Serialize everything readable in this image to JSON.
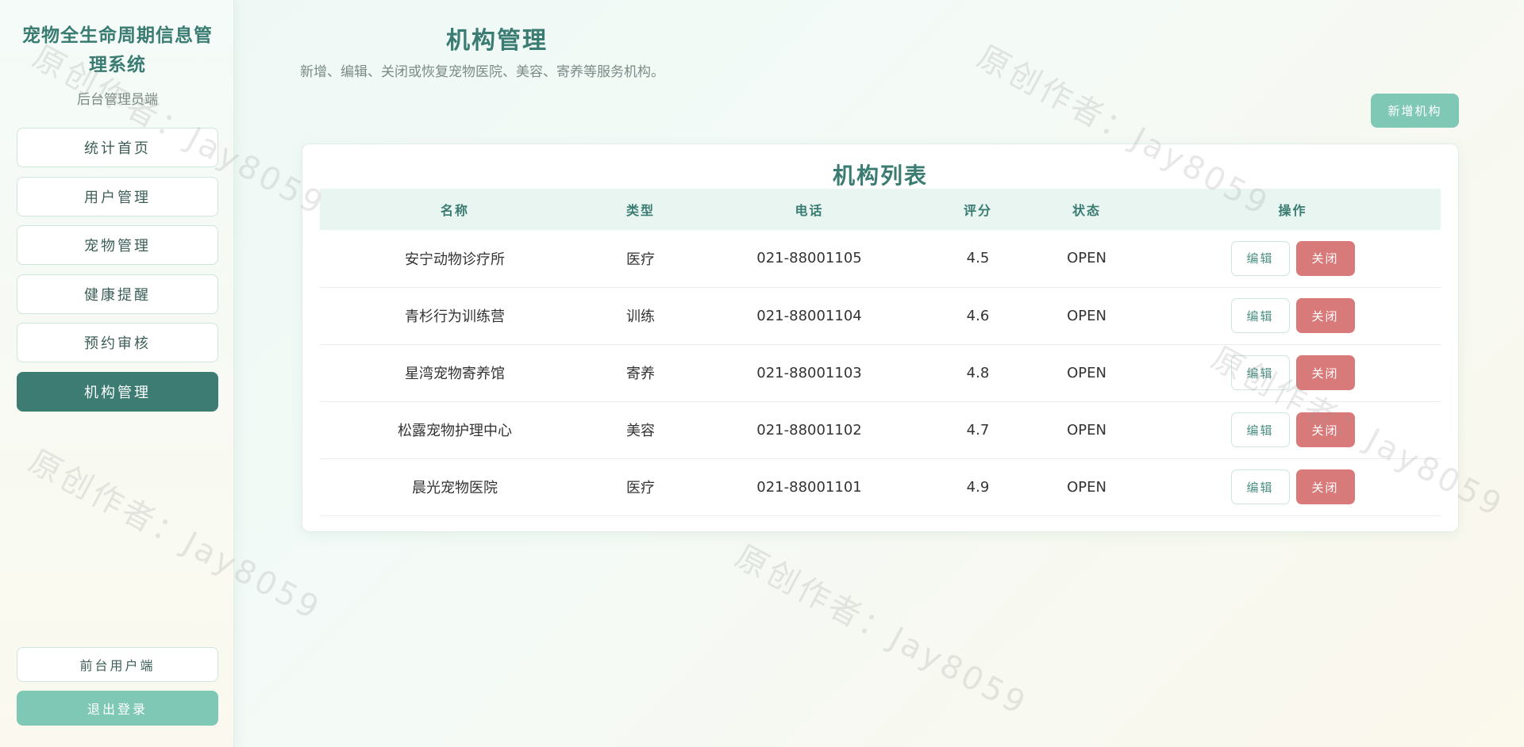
{
  "sidebar": {
    "title": "宠物全生命周期信息管理系统",
    "subtitle": "后台管理员端",
    "nav": [
      {
        "label": "统计首页",
        "active": false
      },
      {
        "label": "用户管理",
        "active": false
      },
      {
        "label": "宠物管理",
        "active": false
      },
      {
        "label": "健康提醒",
        "active": false
      },
      {
        "label": "预约审核",
        "active": false
      },
      {
        "label": "机构管理",
        "active": true
      }
    ],
    "front_label": "前台用户端",
    "logout_label": "退出登录"
  },
  "header": {
    "title": "机构管理",
    "subtitle": "新增、编辑、关闭或恢复宠物医院、美容、寄养等服务机构。",
    "add_label": "新增机构"
  },
  "table": {
    "title": "机构列表",
    "columns": [
      "名称",
      "类型",
      "电话",
      "评分",
      "状态",
      "操作"
    ],
    "rows": [
      {
        "name": "安宁动物诊疗所",
        "type": "医疗",
        "phone": "021-88001105",
        "rating": "4.5",
        "status": "OPEN"
      },
      {
        "name": "青杉行为训练营",
        "type": "训练",
        "phone": "021-88001104",
        "rating": "4.6",
        "status": "OPEN"
      },
      {
        "name": "星湾宠物寄养馆",
        "type": "寄养",
        "phone": "021-88001103",
        "rating": "4.8",
        "status": "OPEN"
      },
      {
        "name": "松露宠物护理中心",
        "type": "美容",
        "phone": "021-88001102",
        "rating": "4.7",
        "status": "OPEN"
      },
      {
        "name": "晨光宠物医院",
        "type": "医疗",
        "phone": "021-88001101",
        "rating": "4.9",
        "status": "OPEN"
      }
    ],
    "edit_label": "编辑",
    "close_label": "关闭"
  },
  "watermark": "原创作者：Jay8059",
  "colors": {
    "accent": "#3c7c72",
    "accent_light": "#7fc8b6",
    "danger": "#d97a7a"
  }
}
